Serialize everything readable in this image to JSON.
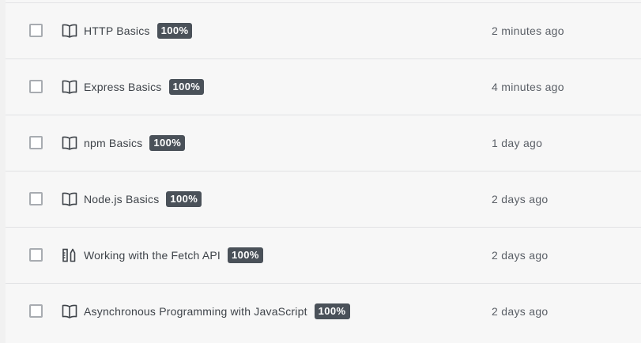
{
  "activity": {
    "items": [
      {
        "title": "HTTP Basics",
        "progress": "100%",
        "time": "2 minutes ago",
        "icon": "book-icon"
      },
      {
        "title": "Express Basics",
        "progress": "100%",
        "time": "4 minutes ago",
        "icon": "book-icon"
      },
      {
        "title": "npm Basics",
        "progress": "100%",
        "time": "1 day ago",
        "icon": "book-icon"
      },
      {
        "title": "Node.js Basics",
        "progress": "100%",
        "time": "2 days ago",
        "icon": "book-icon"
      },
      {
        "title": "Working with the Fetch API",
        "progress": "100%",
        "time": "2 days ago",
        "icon": "tools-icon"
      },
      {
        "title": "Asynchronous Programming with JavaScript",
        "progress": "100%",
        "time": "2 days ago",
        "icon": "book-icon"
      }
    ]
  },
  "colors": {
    "badge_bg": "#4a5159",
    "badge_text": "#ffffff",
    "row_bg": "#f7f7f7",
    "divider": "#e1e2e4",
    "checkbox_border": "#a8acb1"
  }
}
